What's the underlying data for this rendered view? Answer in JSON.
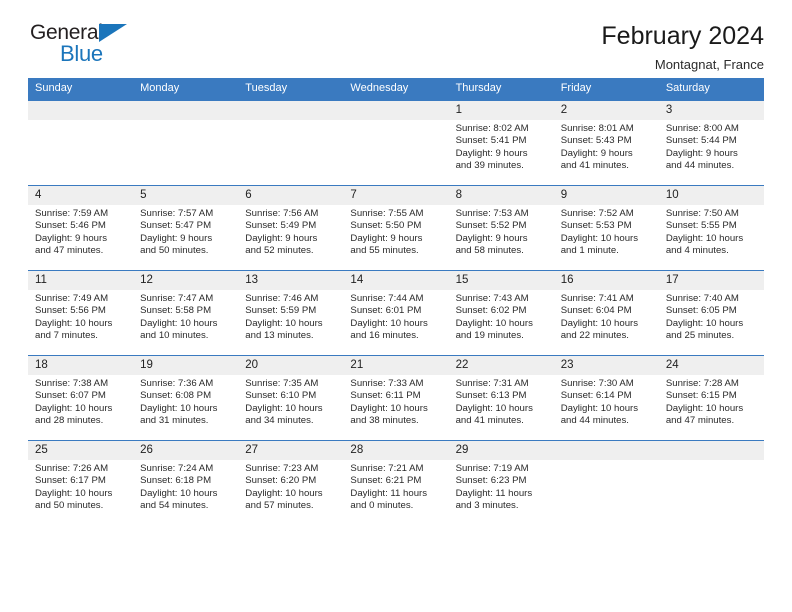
{
  "brand": {
    "name_top": "General",
    "name_bottom": "Blue",
    "accent_color": "#1b75bb"
  },
  "header": {
    "title": "February 2024",
    "subtitle": "Montagnat, France"
  },
  "theme": {
    "header_row_color": "#3a7ac0",
    "daynum_strip_color": "#efefef",
    "text_color": "#2a2a2a"
  },
  "weekdays": [
    "Sunday",
    "Monday",
    "Tuesday",
    "Wednesday",
    "Thursday",
    "Friday",
    "Saturday"
  ],
  "weeks": [
    [
      {
        "day": "",
        "lines": []
      },
      {
        "day": "",
        "lines": []
      },
      {
        "day": "",
        "lines": []
      },
      {
        "day": "",
        "lines": []
      },
      {
        "day": "1",
        "lines": [
          "Sunrise: 8:02 AM",
          "Sunset: 5:41 PM",
          "Daylight: 9 hours",
          "and 39 minutes."
        ]
      },
      {
        "day": "2",
        "lines": [
          "Sunrise: 8:01 AM",
          "Sunset: 5:43 PM",
          "Daylight: 9 hours",
          "and 41 minutes."
        ]
      },
      {
        "day": "3",
        "lines": [
          "Sunrise: 8:00 AM",
          "Sunset: 5:44 PM",
          "Daylight: 9 hours",
          "and 44 minutes."
        ]
      }
    ],
    [
      {
        "day": "4",
        "lines": [
          "Sunrise: 7:59 AM",
          "Sunset: 5:46 PM",
          "Daylight: 9 hours",
          "and 47 minutes."
        ]
      },
      {
        "day": "5",
        "lines": [
          "Sunrise: 7:57 AM",
          "Sunset: 5:47 PM",
          "Daylight: 9 hours",
          "and 50 minutes."
        ]
      },
      {
        "day": "6",
        "lines": [
          "Sunrise: 7:56 AM",
          "Sunset: 5:49 PM",
          "Daylight: 9 hours",
          "and 52 minutes."
        ]
      },
      {
        "day": "7",
        "lines": [
          "Sunrise: 7:55 AM",
          "Sunset: 5:50 PM",
          "Daylight: 9 hours",
          "and 55 minutes."
        ]
      },
      {
        "day": "8",
        "lines": [
          "Sunrise: 7:53 AM",
          "Sunset: 5:52 PM",
          "Daylight: 9 hours",
          "and 58 minutes."
        ]
      },
      {
        "day": "9",
        "lines": [
          "Sunrise: 7:52 AM",
          "Sunset: 5:53 PM",
          "Daylight: 10 hours",
          "and 1 minute."
        ]
      },
      {
        "day": "10",
        "lines": [
          "Sunrise: 7:50 AM",
          "Sunset: 5:55 PM",
          "Daylight: 10 hours",
          "and 4 minutes."
        ]
      }
    ],
    [
      {
        "day": "11",
        "lines": [
          "Sunrise: 7:49 AM",
          "Sunset: 5:56 PM",
          "Daylight: 10 hours",
          "and 7 minutes."
        ]
      },
      {
        "day": "12",
        "lines": [
          "Sunrise: 7:47 AM",
          "Sunset: 5:58 PM",
          "Daylight: 10 hours",
          "and 10 minutes."
        ]
      },
      {
        "day": "13",
        "lines": [
          "Sunrise: 7:46 AM",
          "Sunset: 5:59 PM",
          "Daylight: 10 hours",
          "and 13 minutes."
        ]
      },
      {
        "day": "14",
        "lines": [
          "Sunrise: 7:44 AM",
          "Sunset: 6:01 PM",
          "Daylight: 10 hours",
          "and 16 minutes."
        ]
      },
      {
        "day": "15",
        "lines": [
          "Sunrise: 7:43 AM",
          "Sunset: 6:02 PM",
          "Daylight: 10 hours",
          "and 19 minutes."
        ]
      },
      {
        "day": "16",
        "lines": [
          "Sunrise: 7:41 AM",
          "Sunset: 6:04 PM",
          "Daylight: 10 hours",
          "and 22 minutes."
        ]
      },
      {
        "day": "17",
        "lines": [
          "Sunrise: 7:40 AM",
          "Sunset: 6:05 PM",
          "Daylight: 10 hours",
          "and 25 minutes."
        ]
      }
    ],
    [
      {
        "day": "18",
        "lines": [
          "Sunrise: 7:38 AM",
          "Sunset: 6:07 PM",
          "Daylight: 10 hours",
          "and 28 minutes."
        ]
      },
      {
        "day": "19",
        "lines": [
          "Sunrise: 7:36 AM",
          "Sunset: 6:08 PM",
          "Daylight: 10 hours",
          "and 31 minutes."
        ]
      },
      {
        "day": "20",
        "lines": [
          "Sunrise: 7:35 AM",
          "Sunset: 6:10 PM",
          "Daylight: 10 hours",
          "and 34 minutes."
        ]
      },
      {
        "day": "21",
        "lines": [
          "Sunrise: 7:33 AM",
          "Sunset: 6:11 PM",
          "Daylight: 10 hours",
          "and 38 minutes."
        ]
      },
      {
        "day": "22",
        "lines": [
          "Sunrise: 7:31 AM",
          "Sunset: 6:13 PM",
          "Daylight: 10 hours",
          "and 41 minutes."
        ]
      },
      {
        "day": "23",
        "lines": [
          "Sunrise: 7:30 AM",
          "Sunset: 6:14 PM",
          "Daylight: 10 hours",
          "and 44 minutes."
        ]
      },
      {
        "day": "24",
        "lines": [
          "Sunrise: 7:28 AM",
          "Sunset: 6:15 PM",
          "Daylight: 10 hours",
          "and 47 minutes."
        ]
      }
    ],
    [
      {
        "day": "25",
        "lines": [
          "Sunrise: 7:26 AM",
          "Sunset: 6:17 PM",
          "Daylight: 10 hours",
          "and 50 minutes."
        ]
      },
      {
        "day": "26",
        "lines": [
          "Sunrise: 7:24 AM",
          "Sunset: 6:18 PM",
          "Daylight: 10 hours",
          "and 54 minutes."
        ]
      },
      {
        "day": "27",
        "lines": [
          "Sunrise: 7:23 AM",
          "Sunset: 6:20 PM",
          "Daylight: 10 hours",
          "and 57 minutes."
        ]
      },
      {
        "day": "28",
        "lines": [
          "Sunrise: 7:21 AM",
          "Sunset: 6:21 PM",
          "Daylight: 11 hours",
          "and 0 minutes."
        ]
      },
      {
        "day": "29",
        "lines": [
          "Sunrise: 7:19 AM",
          "Sunset: 6:23 PM",
          "Daylight: 11 hours",
          "and 3 minutes."
        ]
      },
      {
        "day": "",
        "lines": []
      },
      {
        "day": "",
        "lines": []
      }
    ]
  ]
}
